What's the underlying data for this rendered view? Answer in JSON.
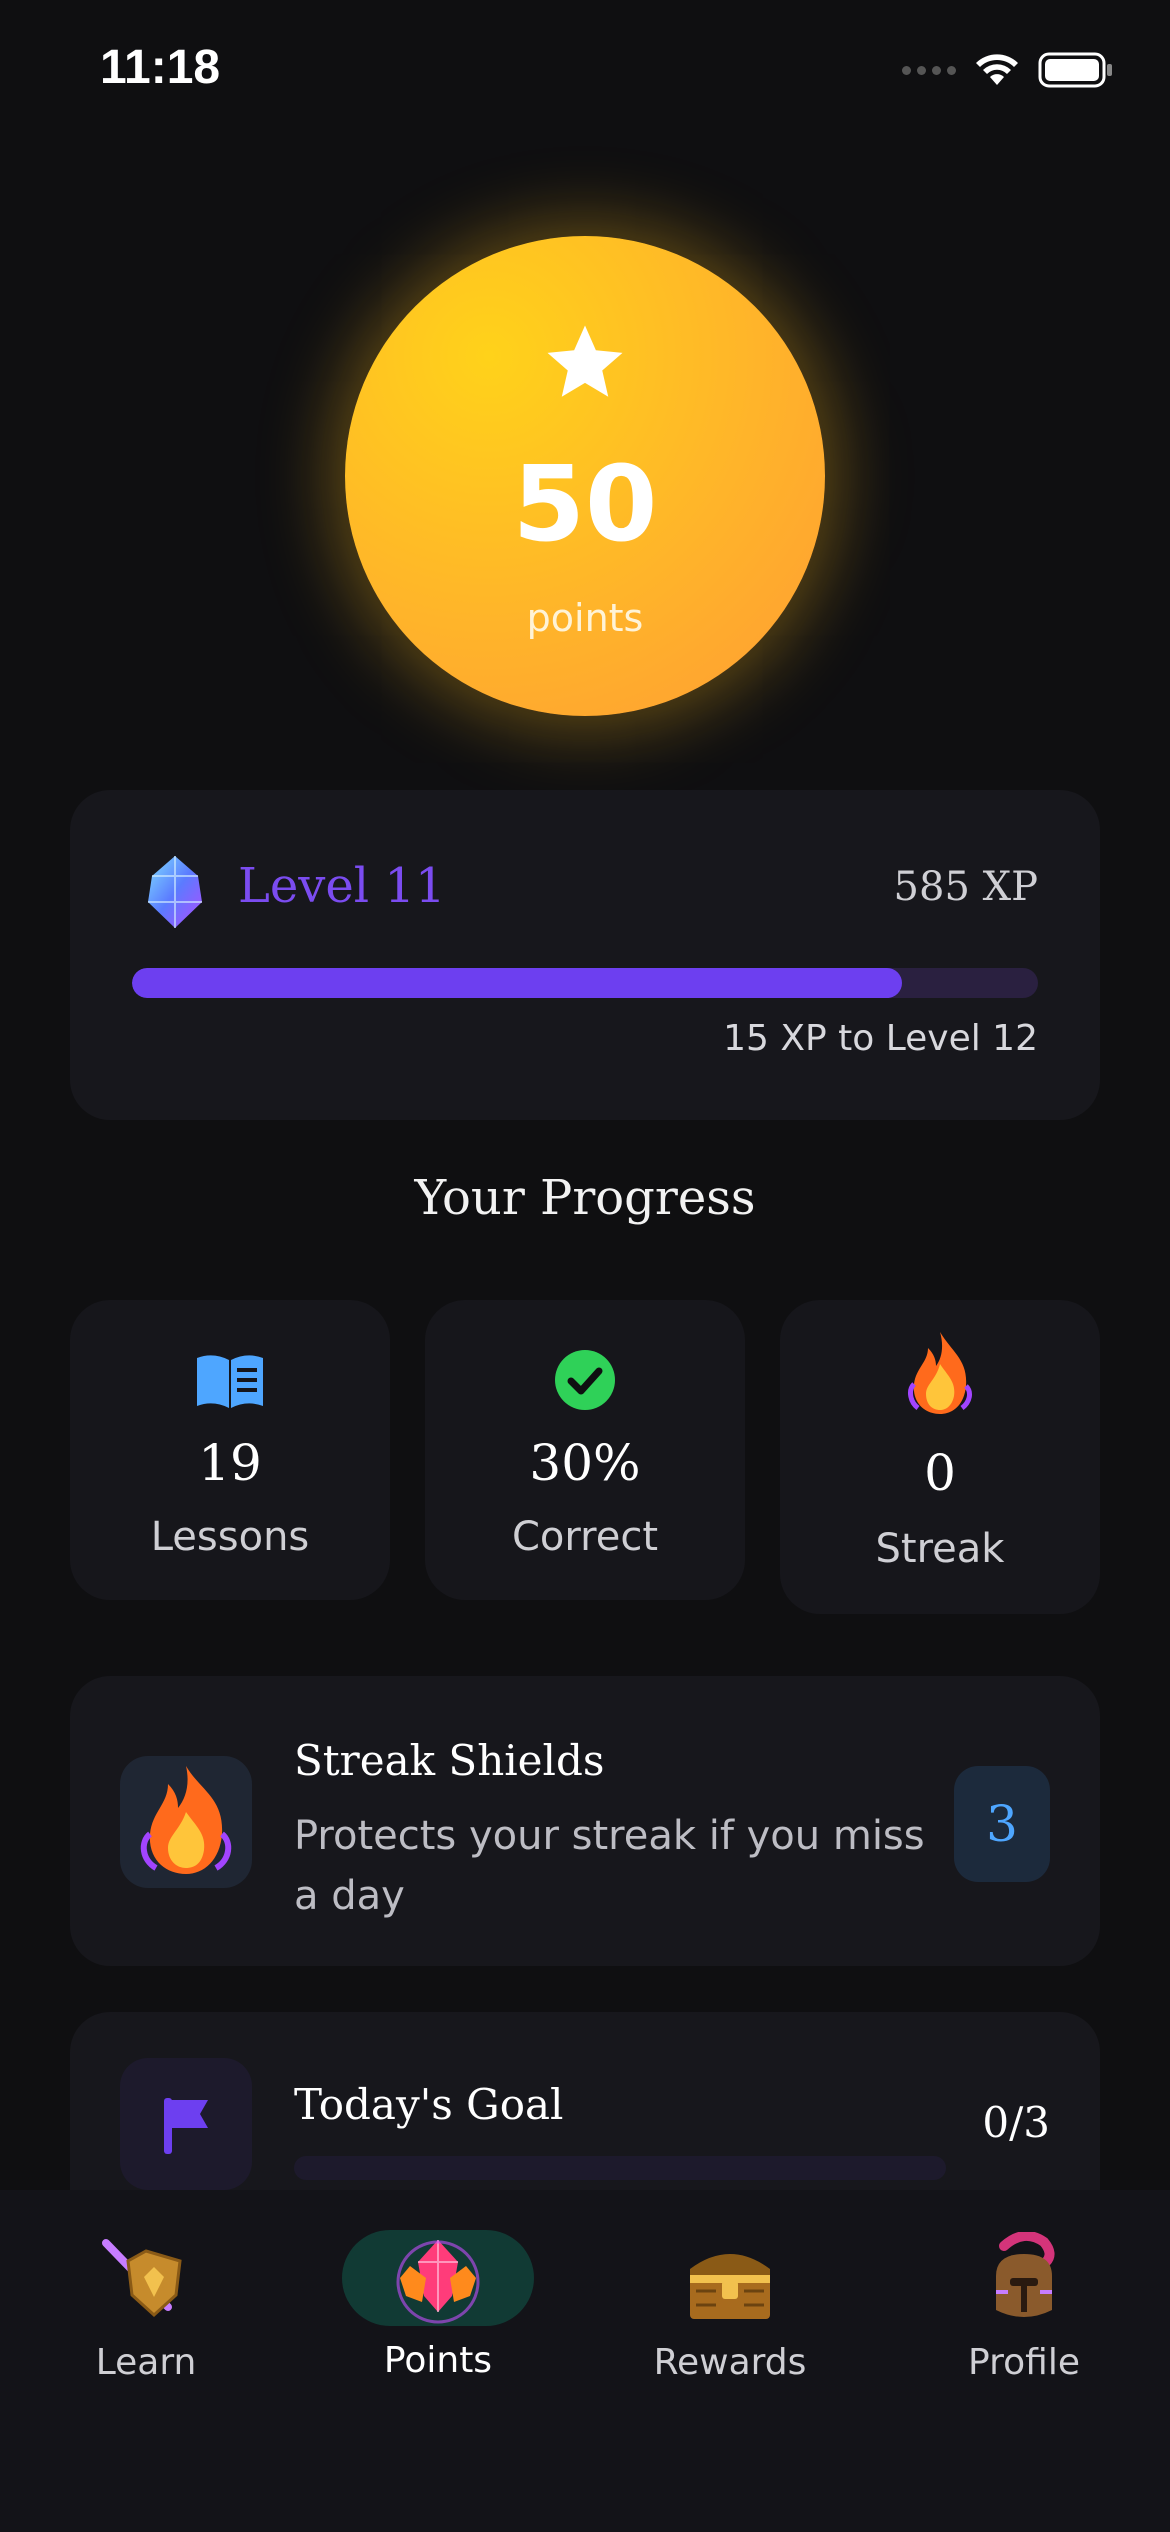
{
  "status_bar": {
    "time": "11:18"
  },
  "points": {
    "value": "50",
    "label": "points"
  },
  "level": {
    "title": "Level 11",
    "xp": "585 XP",
    "progress_fraction": 0.85,
    "next_text": "15 XP to Level 12"
  },
  "section_title": "Your Progress",
  "stats": [
    {
      "value": "19",
      "label": "Lessons",
      "icon": "book-icon",
      "color": "#4ea6ff"
    },
    {
      "value": "30%",
      "label": "Correct",
      "icon": "check-circle-icon",
      "color": "#2fd158"
    },
    {
      "value": "0",
      "label": "Streak",
      "icon": "flame-icon",
      "color": "#ff8a1c"
    }
  ],
  "shield": {
    "title": "Streak Shields",
    "description": "Protects your streak if you miss a day",
    "count": "3"
  },
  "goal": {
    "title": "Today's Goal",
    "count": "0/3",
    "progress_fraction": 0
  },
  "nav": [
    {
      "label": "Learn",
      "icon": "sword-shield-icon",
      "active": false
    },
    {
      "label": "Points",
      "icon": "gem-cluster-icon",
      "active": true
    },
    {
      "label": "Rewards",
      "icon": "treasure-chest-icon",
      "active": false
    },
    {
      "label": "Profile",
      "icon": "helmet-icon",
      "active": false
    }
  ],
  "colors": {
    "accent_purple": "#6d3ff0",
    "points_gold": "#ffb42a",
    "blue": "#4ea6ff",
    "green": "#2fd158",
    "background": "#0f0f11"
  }
}
